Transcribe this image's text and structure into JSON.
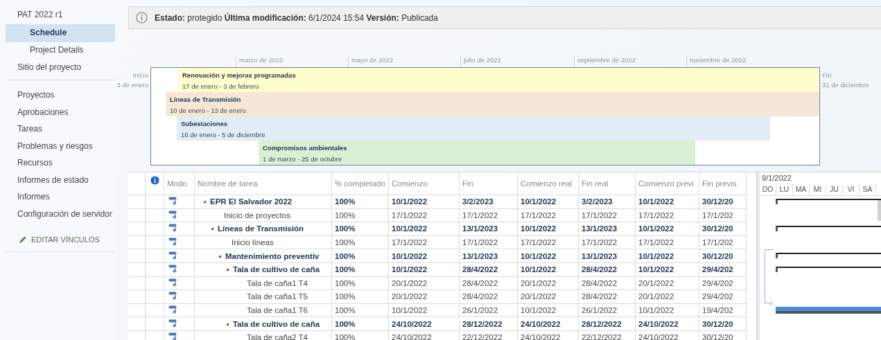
{
  "sidebar": {
    "items": [
      {
        "label": "PAT 2022 r1",
        "selected": false,
        "children": [
          {
            "label": "Schedule",
            "selected": true
          },
          {
            "label": "Project Details",
            "selected": false
          }
        ]
      },
      {
        "label": "Sitio del proyecto",
        "selected": false
      }
    ],
    "items_2": [
      {
        "label": "Proyectos",
        "selected": false
      },
      {
        "label": "Aprobaciones",
        "selected": false
      },
      {
        "label": "Tareas",
        "selected": false
      },
      {
        "label": "Problemas y riesgos",
        "selected": false
      },
      {
        "label": "Recursos",
        "selected": false
      },
      {
        "label": "Informes de estado",
        "selected": false
      },
      {
        "label": "Informes",
        "selected": false
      },
      {
        "label": "Configuración de servidor",
        "selected": false
      }
    ],
    "edit_links": "EDITAR VÍNCULOS"
  },
  "status_bar": {
    "text": "**Estado:** protegido **Última modificación:** 6/1/2024 15:54 **Versión:** Publicada"
  },
  "timeline": {
    "months": [
      "marzo de 2022",
      "mayo de 2022",
      "julio de 2022",
      "septiembre de 2022",
      "noviembre de 2022"
    ],
    "start_label": "Inicio",
    "start_date": "3 de enero",
    "end_label": "Fin",
    "end_date": "31 de diciembre",
    "bars": [
      {
        "title": "Renovación y mejoras programadas",
        "dates": "17 de enero - 3 de febrero",
        "color": "#fefdcb"
      },
      {
        "title": "Líneas de Transmisión",
        "dates": "10 de enero - 13 de enero",
        "color": "#f5e7d5"
      },
      {
        "title": "Subestaciones",
        "dates": "16 de enero - 5 de diciembre",
        "color": "#e1edf6"
      },
      {
        "title": "Compromisos ambientales",
        "dates": "1 de marzo - 25 de octubre",
        "color": "#d9f0d5"
      }
    ]
  },
  "table": {
    "mode_header": "Modo",
    "name_header": "Nombre de tarea",
    "columns": [
      "% completado",
      "Comienzo",
      "Fin",
      "Comienzo real",
      "Fin real",
      "Comienzo previ",
      "Fin previs"
    ],
    "rows": [
      {
        "name": "EPR El Salvador 2022",
        "summary": true,
        "expanded": true,
        "kind": "bracket",
        "cells": [
          "100%",
          "10/1/2022",
          "3/2/2023",
          "10/1/2022",
          "3/2/2023",
          "10/1/2022",
          "30/12/20"
        ],
        "children": [
          {
            "name": "Inicio de proyectos",
            "summary": false,
            "cells": [
              "100%",
              "17/1/2022",
              "17/1/2022",
              "17/1/2022",
              "17/1/2022",
              "17/1/2022",
              "17/1/202"
            ]
          },
          {
            "name": "Líneas de Transmisión",
            "summary": true,
            "expanded": true,
            "kind": "bracket",
            "cells": [
              "100%",
              "10/1/2022",
              "13/1/2023",
              "10/1/2022",
              "13/1/2023",
              "10/1/2022",
              "30/12/20"
            ],
            "children": [
              {
                "name": "Inicio líneas",
                "summary": false,
                "cells": [
                  "100%",
                  "17/1/2022",
                  "17/1/2022",
                  "17/1/2022",
                  "17/1/2022",
                  "17/1/2022",
                  "17/1/202"
                ]
              },
              {
                "name": "Mantenimiento preventiv",
                "summary": true,
                "expanded": true,
                "kind": "bracket",
                "cells": [
                  "100%",
                  "10/1/2022",
                  "13/1/2023",
                  "10/1/2022",
                  "13/1/2023",
                  "10/1/2022",
                  "30/12/20"
                ],
                "children": [
                  {
                    "name": "Tala de cultivo de caña",
                    "summary": true,
                    "expanded": true,
                    "kind": "bracket",
                    "cells": [
                      "100%",
                      "10/1/2022",
                      "28/4/2022",
                      "10/1/2022",
                      "28/4/2022",
                      "10/1/2022",
                      "29/4/202"
                    ],
                    "children": [
                      {
                        "name": "Tala de caña1 T4",
                        "summary": false,
                        "cells": [
                          "100%",
                          "20/1/2022",
                          "28/4/2022",
                          "20/1/2022",
                          "28/4/2022",
                          "20/1/2022",
                          "29/4/202"
                        ]
                      },
                      {
                        "name": "Tala de caña1 T5",
                        "summary": false,
                        "cells": [
                          "100%",
                          "20/1/2022",
                          "28/4/2022",
                          "20/1/2022",
                          "28/4/2022",
                          "20/1/2022",
                          "29/4/202"
                        ]
                      },
                      {
                        "name": "Tala de caña1 T6",
                        "summary": false,
                        "kind": "bar",
                        "cells": [
                          "100%",
                          "10/1/2022",
                          "26/1/2022",
                          "10/1/2022",
                          "26/1/2022",
                          "10/1/2022",
                          "19/4/202"
                        ]
                      }
                    ]
                  },
                  {
                    "name": "Tala de cultivo de caña",
                    "summary": true,
                    "expanded": true,
                    "cells": [
                      "100%",
                      "24/10/2022",
                      "28/12/2022",
                      "24/10/2022",
                      "28/12/2022",
                      "24/10/2022",
                      "30/12/20"
                    ],
                    "children": [
                      {
                        "name": "Tala de caña2 T4",
                        "summary": false,
                        "cells": [
                          "100%",
                          "24/10/2022",
                          "22/12/2022",
                          "24/10/2022",
                          "22/12/2022",
                          "24/10/2022",
                          "30/12/20"
                        ]
                      }
                    ]
                  }
                ]
              }
            ]
          }
        ]
      }
    ]
  },
  "gantt": {
    "date": "9/1/2022",
    "days": [
      "DO",
      "LU",
      "MA",
      "MI",
      "JU",
      "VI",
      "SA"
    ]
  }
}
